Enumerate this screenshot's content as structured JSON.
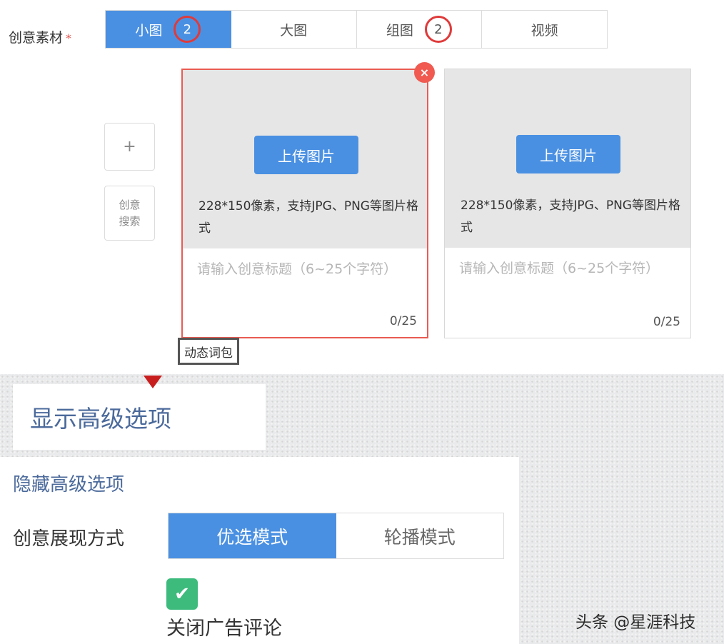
{
  "creative_material": {
    "label": "创意素材",
    "required_mark": "*",
    "tabs": [
      {
        "label": "小图",
        "count": "2",
        "active": true
      },
      {
        "label": "大图",
        "count": "",
        "active": false
      },
      {
        "label": "组图",
        "count": "2",
        "active": false
      },
      {
        "label": "视频",
        "count": "",
        "active": false
      }
    ],
    "add_button": "+",
    "search_button": "创意搜索",
    "cards": [
      {
        "upload_label": "上传图片",
        "upload_tip": "228*150像素，支持JPG、PNG等图片格式",
        "title_placeholder": "请输入创意标题（6~25个字符）",
        "counter": "0/25",
        "close": "×"
      },
      {
        "upload_label": "上传图片",
        "upload_tip": "228*150像素，支持JPG、PNG等图片格式",
        "title_placeholder": "请输入创意标题（6~25个字符）",
        "counter": "0/25"
      }
    ],
    "dynamic_words": "动态词包"
  },
  "advanced": {
    "show_label": "显示高级选项",
    "hide_label": "隐藏高级选项",
    "display_mode_label": "创意展现方式",
    "modes": [
      {
        "label": "优选模式",
        "active": true
      },
      {
        "label": "轮播模式",
        "active": false
      }
    ],
    "check_icon": "✔",
    "close_comments_label": "关闭广告评论"
  },
  "watermark": "头条 @星涯科技",
  "colors": {
    "accent": "#4a90e2",
    "highlight_circle": "#e03a3a",
    "close_button": "#f05a50",
    "checkbox": "#3dbb7d",
    "advanced_text": "#4b6a9b"
  }
}
